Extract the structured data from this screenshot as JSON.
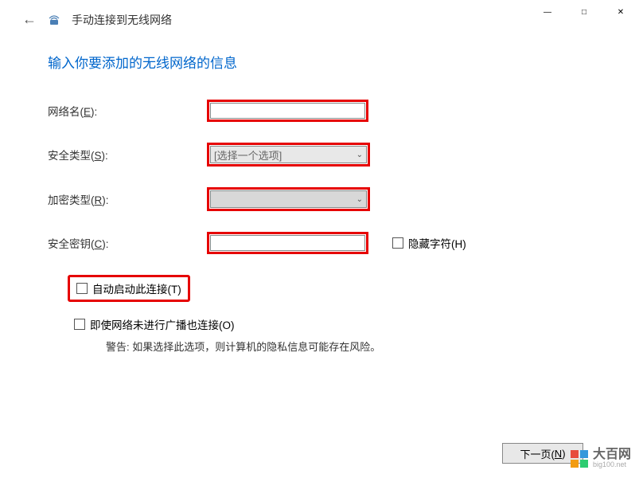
{
  "titlebar": {
    "minimize": "—",
    "maximize": "□",
    "close": "✕"
  },
  "header": {
    "title": "手动连接到无线网络"
  },
  "heading": "输入你要添加的无线网络的信息",
  "form": {
    "network_name": {
      "label": "网络名(",
      "hotkey": "E",
      "label_end": "):",
      "value": ""
    },
    "security_type": {
      "label": "安全类型(",
      "hotkey": "S",
      "label_end": "):",
      "value": "[选择一个选项]"
    },
    "encryption_type": {
      "label": "加密类型(",
      "hotkey": "R",
      "label_end": "):",
      "value": ""
    },
    "security_key": {
      "label": "安全密钥(",
      "hotkey": "C",
      "label_end": "):",
      "value": ""
    },
    "hide_chars": {
      "label": "隐藏字符(",
      "hotkey": "H",
      "label_end": ")"
    },
    "auto_start": {
      "label": "自动启动此连接(",
      "hotkey": "T",
      "label_end": ")"
    },
    "connect_hidden": {
      "label": "即使网络未进行广播也连接(",
      "hotkey": "O",
      "label_end": ")"
    },
    "warning": "警告: 如果选择此选项，则计算机的隐私信息可能存在风险。"
  },
  "footer": {
    "next": "下一页(",
    "next_hotkey": "N",
    "next_end": ")"
  },
  "watermark": {
    "main": "大百网",
    "sub": "big100.net"
  }
}
